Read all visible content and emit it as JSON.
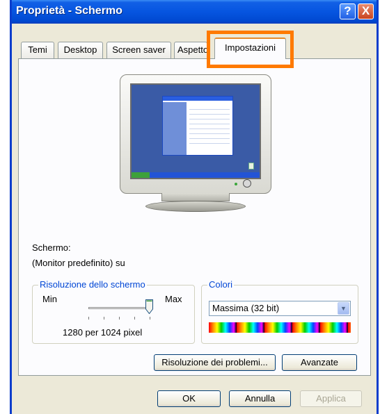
{
  "window": {
    "title": "Proprietà - Schermo",
    "help_label": "?",
    "close_label": "X"
  },
  "tabs": [
    {
      "label": "Temi"
    },
    {
      "label": "Desktop"
    },
    {
      "label": "Screen saver"
    },
    {
      "label": "Aspetto"
    },
    {
      "label": "Impostazioni"
    }
  ],
  "active_tab": "Impostazioni",
  "highlight_color": "#ff7a00",
  "display": {
    "label": "Schermo:",
    "device": "(Monitor predefinito) su"
  },
  "resolution": {
    "legend": "Risoluzione dello schermo",
    "min_label": "Min",
    "max_label": "Max",
    "value_text": "1280 per 1024 pixel",
    "slider_position_fraction": 0.9
  },
  "colors": {
    "legend": "Colori",
    "selected": "Massima (32 bit)",
    "arrow_icon": "chevron-down-icon"
  },
  "buttons": {
    "troubleshoot": "Risoluzione dei problemi...",
    "advanced": "Avanzate",
    "ok": "OK",
    "cancel": "Annulla",
    "apply": "Applica"
  }
}
